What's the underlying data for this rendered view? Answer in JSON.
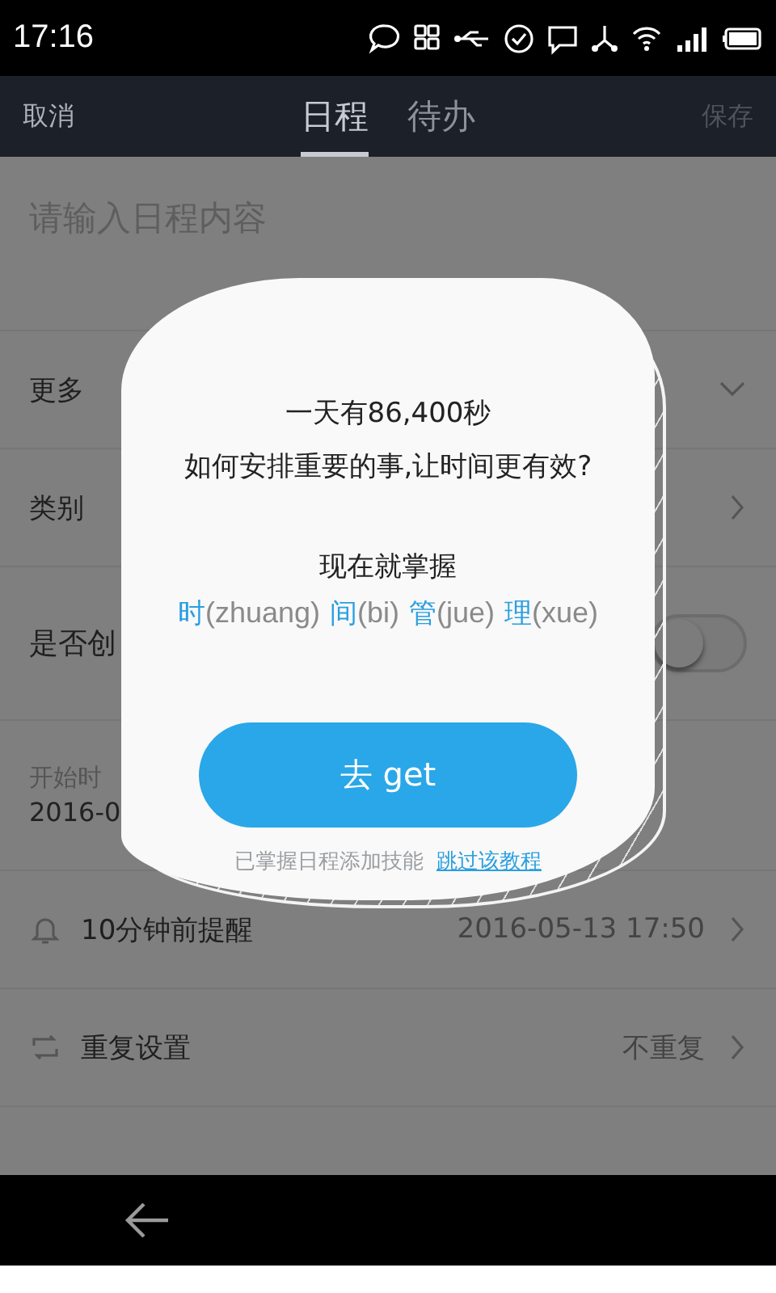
{
  "status_bar": {
    "time": "17:16"
  },
  "header": {
    "cancel": "取消",
    "save": {
      "label": "保存",
      "disabled": true
    },
    "tabs": [
      {
        "label": "日程",
        "selected": true
      },
      {
        "label": "待办",
        "selected": false
      }
    ]
  },
  "content_field": {
    "placeholder": "请输入日程内容"
  },
  "rows": [
    {
      "kind": "expand",
      "label": "更多"
    },
    {
      "kind": "link",
      "label": "类别"
    },
    {
      "kind": "toggle",
      "label": "是否创",
      "on": false
    },
    {
      "kind": "time",
      "label": "开始时",
      "value": "2016-0"
    },
    {
      "kind": "reminder",
      "label": "10分钟前提醒",
      "value": "2016-05-13 17:50"
    },
    {
      "kind": "repeat",
      "label": "重复设置",
      "value": "不重复"
    },
    {
      "kind": "empty"
    }
  ],
  "dialog": {
    "lines": [
      "一天有86,400秒",
      "如何安排重要的事,让时间更有效?"
    ],
    "subtitle": "现在就掌握",
    "words": [
      {
        "char": "时",
        "pinyin": "(zhuang)"
      },
      {
        "char": "间",
        "pinyin": "(bi)"
      },
      {
        "char": "管",
        "pinyin": "(jue)"
      },
      {
        "char": "理",
        "pinyin": "(xue)"
      }
    ],
    "button": "去 get",
    "note": "已掌握日程添加技能",
    "skip_link": "跳过该教程"
  }
}
